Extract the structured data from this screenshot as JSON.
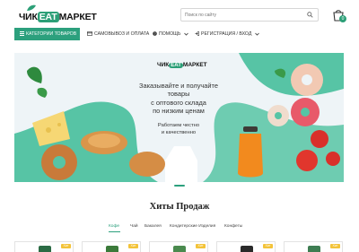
{
  "header": {
    "logo_prefix": "ЧИК",
    "logo_badge": "ЕАТ",
    "logo_suffix": "МАРКЕТ",
    "search_placeholder": "Поиск по сайту",
    "cart_count": "0"
  },
  "nav": {
    "categories": "КАТЕГОРИИ ТОВАРОВ",
    "pickup": "САМОВЫВОЗ И ОПЛАТА",
    "help": "ПОМОЩЬ",
    "login": "РЕГИСТРАЦИЯ / ВХОД"
  },
  "banner": {
    "logo_prefix": "ЧИК",
    "logo_badge": "ЕАТ",
    "logo_suffix": "МАРКЕТ",
    "headline_1": "Заказывайте и получайте",
    "headline_2": "товары",
    "headline_3": "с оптового склада",
    "headline_4": "по низким ценам",
    "sub_1": "Работаем честно",
    "sub_2": "и качественно"
  },
  "section": {
    "title": "Хиты Продаж",
    "tabs": [
      "Кофе",
      "Чай",
      "Бакалея",
      "Кондитерские Изделия",
      "Конфеты"
    ]
  },
  "cards": [
    {
      "badge": "Хит"
    },
    {
      "badge": "Хит"
    },
    {
      "badge": "Хит"
    },
    {
      "badge": "Хит"
    },
    {
      "badge": "Хит"
    }
  ],
  "colors": {
    "accent": "#2ca07d",
    "badge": "#f3c339"
  }
}
